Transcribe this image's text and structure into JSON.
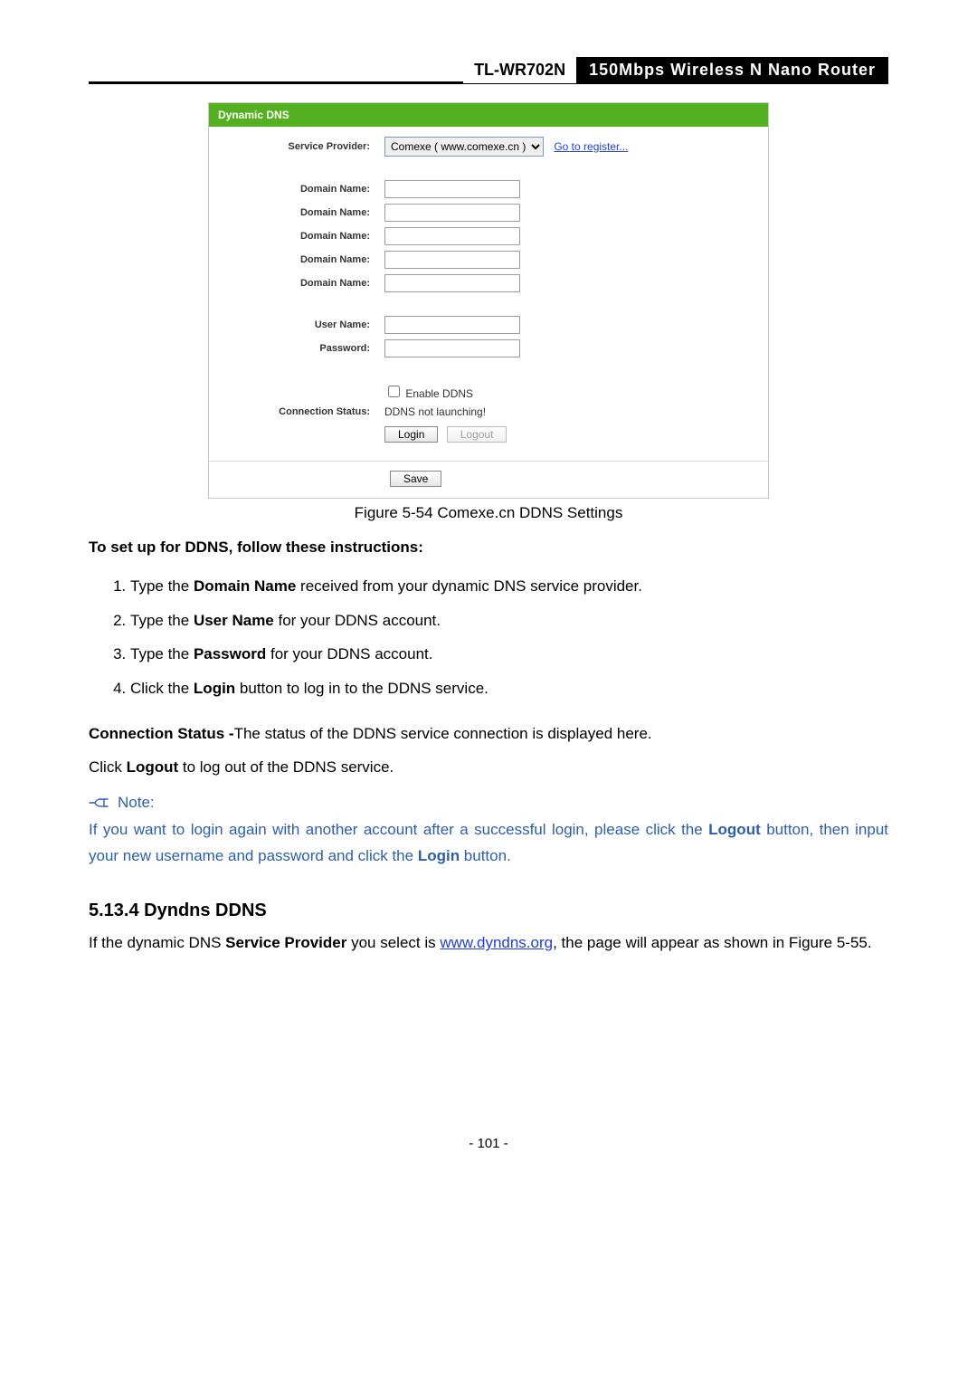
{
  "header": {
    "model": "TL-WR702N",
    "product": "150Mbps  Wireless  N  Nano  Router"
  },
  "shot": {
    "title": "Dynamic DNS",
    "labels": {
      "service_provider": "Service Provider:",
      "domain_name": "Domain Name:",
      "user_name": "User Name:",
      "password": "Password:",
      "connection_status": "Connection Status:"
    },
    "service_provider_option": "Comexe ( www.comexe.cn )",
    "register_link": "Go to register...",
    "enable_label": "Enable DDNS",
    "status_text": "DDNS not launching!",
    "buttons": {
      "login": "Login",
      "logout": "Logout",
      "save": "Save"
    }
  },
  "caption": "Figure 5-54 Comexe.cn DDNS Settings",
  "instructions_lead": "To set up for DDNS, follow these instructions:",
  "steps": {
    "s1_a": "Type the ",
    "s1_b": "Domain Name",
    "s1_c": " received from your dynamic DNS service provider.",
    "s2_a": "Type the ",
    "s2_b": "User Name",
    "s2_c": " for your DDNS account.",
    "s3_a": "Type the ",
    "s3_b": "Password",
    "s3_c": " for your DDNS account.",
    "s4_a": "Click the ",
    "s4_b": "Login",
    "s4_c": " button to log in to the DDNS service."
  },
  "conn": {
    "a": "Connection Status -",
    "b": "The status of the DDNS service connection is displayed here."
  },
  "logout_line": {
    "a": "Click ",
    "b": "Logout",
    "c": " to log out of the DDNS service."
  },
  "note": {
    "head": "Note:",
    "a": "If you want to login again with another account after a successful login, please click the ",
    "b": "Logout",
    "c": " button, then input your new username and password and click the ",
    "d": "Login",
    "e": " button."
  },
  "section_heading": "5.13.4  Dyndns DDNS",
  "sec_body": {
    "a": "If the dynamic DNS ",
    "b": "Service Provider",
    "c": " you select is ",
    "link": "www.dyndns.org",
    "d": ", the page will appear as shown in Figure 5-55."
  },
  "page_number": "- 101 -"
}
